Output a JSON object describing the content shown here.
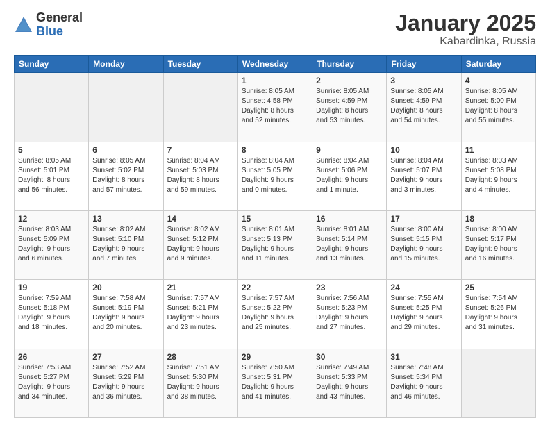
{
  "logo": {
    "general": "General",
    "blue": "Blue"
  },
  "header": {
    "month": "January 2025",
    "location": "Kabardinka, Russia"
  },
  "weekdays": [
    "Sunday",
    "Monday",
    "Tuesday",
    "Wednesday",
    "Thursday",
    "Friday",
    "Saturday"
  ],
  "weeks": [
    [
      {
        "day": "",
        "info": ""
      },
      {
        "day": "",
        "info": ""
      },
      {
        "day": "",
        "info": ""
      },
      {
        "day": "1",
        "info": "Sunrise: 8:05 AM\nSunset: 4:58 PM\nDaylight: 8 hours\nand 52 minutes."
      },
      {
        "day": "2",
        "info": "Sunrise: 8:05 AM\nSunset: 4:59 PM\nDaylight: 8 hours\nand 53 minutes."
      },
      {
        "day": "3",
        "info": "Sunrise: 8:05 AM\nSunset: 4:59 PM\nDaylight: 8 hours\nand 54 minutes."
      },
      {
        "day": "4",
        "info": "Sunrise: 8:05 AM\nSunset: 5:00 PM\nDaylight: 8 hours\nand 55 minutes."
      }
    ],
    [
      {
        "day": "5",
        "info": "Sunrise: 8:05 AM\nSunset: 5:01 PM\nDaylight: 8 hours\nand 56 minutes."
      },
      {
        "day": "6",
        "info": "Sunrise: 8:05 AM\nSunset: 5:02 PM\nDaylight: 8 hours\nand 57 minutes."
      },
      {
        "day": "7",
        "info": "Sunrise: 8:04 AM\nSunset: 5:03 PM\nDaylight: 8 hours\nand 59 minutes."
      },
      {
        "day": "8",
        "info": "Sunrise: 8:04 AM\nSunset: 5:05 PM\nDaylight: 9 hours\nand 0 minutes."
      },
      {
        "day": "9",
        "info": "Sunrise: 8:04 AM\nSunset: 5:06 PM\nDaylight: 9 hours\nand 1 minute."
      },
      {
        "day": "10",
        "info": "Sunrise: 8:04 AM\nSunset: 5:07 PM\nDaylight: 9 hours\nand 3 minutes."
      },
      {
        "day": "11",
        "info": "Sunrise: 8:03 AM\nSunset: 5:08 PM\nDaylight: 9 hours\nand 4 minutes."
      }
    ],
    [
      {
        "day": "12",
        "info": "Sunrise: 8:03 AM\nSunset: 5:09 PM\nDaylight: 9 hours\nand 6 minutes."
      },
      {
        "day": "13",
        "info": "Sunrise: 8:02 AM\nSunset: 5:10 PM\nDaylight: 9 hours\nand 7 minutes."
      },
      {
        "day": "14",
        "info": "Sunrise: 8:02 AM\nSunset: 5:12 PM\nDaylight: 9 hours\nand 9 minutes."
      },
      {
        "day": "15",
        "info": "Sunrise: 8:01 AM\nSunset: 5:13 PM\nDaylight: 9 hours\nand 11 minutes."
      },
      {
        "day": "16",
        "info": "Sunrise: 8:01 AM\nSunset: 5:14 PM\nDaylight: 9 hours\nand 13 minutes."
      },
      {
        "day": "17",
        "info": "Sunrise: 8:00 AM\nSunset: 5:15 PM\nDaylight: 9 hours\nand 15 minutes."
      },
      {
        "day": "18",
        "info": "Sunrise: 8:00 AM\nSunset: 5:17 PM\nDaylight: 9 hours\nand 16 minutes."
      }
    ],
    [
      {
        "day": "19",
        "info": "Sunrise: 7:59 AM\nSunset: 5:18 PM\nDaylight: 9 hours\nand 18 minutes."
      },
      {
        "day": "20",
        "info": "Sunrise: 7:58 AM\nSunset: 5:19 PM\nDaylight: 9 hours\nand 20 minutes."
      },
      {
        "day": "21",
        "info": "Sunrise: 7:57 AM\nSunset: 5:21 PM\nDaylight: 9 hours\nand 23 minutes."
      },
      {
        "day": "22",
        "info": "Sunrise: 7:57 AM\nSunset: 5:22 PM\nDaylight: 9 hours\nand 25 minutes."
      },
      {
        "day": "23",
        "info": "Sunrise: 7:56 AM\nSunset: 5:23 PM\nDaylight: 9 hours\nand 27 minutes."
      },
      {
        "day": "24",
        "info": "Sunrise: 7:55 AM\nSunset: 5:25 PM\nDaylight: 9 hours\nand 29 minutes."
      },
      {
        "day": "25",
        "info": "Sunrise: 7:54 AM\nSunset: 5:26 PM\nDaylight: 9 hours\nand 31 minutes."
      }
    ],
    [
      {
        "day": "26",
        "info": "Sunrise: 7:53 AM\nSunset: 5:27 PM\nDaylight: 9 hours\nand 34 minutes."
      },
      {
        "day": "27",
        "info": "Sunrise: 7:52 AM\nSunset: 5:29 PM\nDaylight: 9 hours\nand 36 minutes."
      },
      {
        "day": "28",
        "info": "Sunrise: 7:51 AM\nSunset: 5:30 PM\nDaylight: 9 hours\nand 38 minutes."
      },
      {
        "day": "29",
        "info": "Sunrise: 7:50 AM\nSunset: 5:31 PM\nDaylight: 9 hours\nand 41 minutes."
      },
      {
        "day": "30",
        "info": "Sunrise: 7:49 AM\nSunset: 5:33 PM\nDaylight: 9 hours\nand 43 minutes."
      },
      {
        "day": "31",
        "info": "Sunrise: 7:48 AM\nSunset: 5:34 PM\nDaylight: 9 hours\nand 46 minutes."
      },
      {
        "day": "",
        "info": ""
      }
    ]
  ]
}
